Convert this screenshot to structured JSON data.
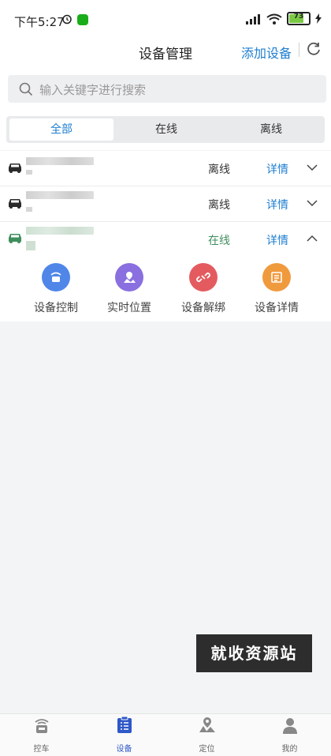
{
  "status_bar": {
    "time": "下午5:27",
    "battery": "73"
  },
  "header": {
    "title": "设备管理",
    "add_label": "添加设备"
  },
  "search": {
    "placeholder": "输入关键字进行搜索"
  },
  "tabs": [
    {
      "label": "全部",
      "active": true
    },
    {
      "label": "在线",
      "active": false
    },
    {
      "label": "离线",
      "active": false
    }
  ],
  "devices": [
    {
      "status": "离线",
      "detail": "详情",
      "expanded": false
    },
    {
      "status": "离线",
      "detail": "详情",
      "expanded": false
    },
    {
      "status": "在线",
      "detail": "详情",
      "expanded": true
    }
  ],
  "actions": [
    {
      "label": "设备控制",
      "icon": "device-control-icon",
      "color": "#4f86e8"
    },
    {
      "label": "实时位置",
      "icon": "realtime-location-icon",
      "color": "#8a6fe0"
    },
    {
      "label": "设备解绑",
      "icon": "unbind-icon",
      "color": "#e45b5f"
    },
    {
      "label": "设备详情",
      "icon": "device-detail-icon",
      "color": "#f09a3e"
    }
  ],
  "watermark": "就收资源站",
  "bottom_nav": [
    {
      "label": "控车",
      "icon": "car-control-icon",
      "active": false
    },
    {
      "label": "设备",
      "icon": "device-list-icon",
      "active": true
    },
    {
      "label": "定位",
      "icon": "location-icon",
      "active": false
    },
    {
      "label": "我的",
      "icon": "profile-icon",
      "active": false
    }
  ],
  "colors": {
    "accent": "#1e7ed0",
    "online": "#3f8f5c",
    "nav_active": "#2f58c8"
  }
}
